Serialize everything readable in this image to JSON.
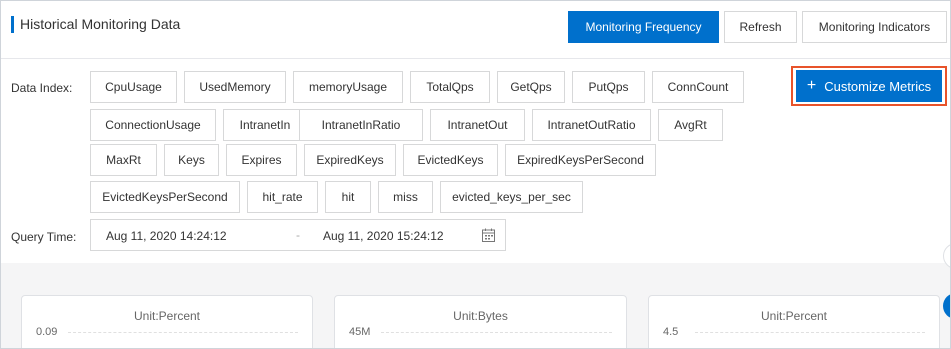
{
  "header": {
    "title": "Historical Monitoring Data",
    "buttons": {
      "monitoring_frequency": "Monitoring Frequency",
      "refresh": "Refresh",
      "monitoring_indicators": "Monitoring Indicators"
    }
  },
  "data_index": {
    "label": "Data Index:",
    "metrics": [
      "CpuUsage",
      "UsedMemory",
      "memoryUsage",
      "TotalQps",
      "GetQps",
      "PutQps",
      "ConnCount",
      "ConnectionUsage",
      "IntranetIn",
      "IntranetInRatio",
      "IntranetOut",
      "IntranetOutRatio",
      "AvgRt",
      "MaxRt",
      "Keys",
      "Expires",
      "ExpiredKeys",
      "EvictedKeys",
      "ExpiredKeysPerSecond",
      "EvictedKeysPerSecond",
      "hit_rate",
      "hit",
      "miss",
      "evicted_keys_per_sec"
    ],
    "customize_label": "Customize Metrics",
    "customize_icon": "plus-icon"
  },
  "query_time": {
    "label": "Query Time:",
    "start": "Aug 11, 2020 14:24:12",
    "separator": "-",
    "end": "Aug 11, 2020 15:24:12",
    "icon": "calendar-icon"
  },
  "charts": [
    {
      "unit": "Unit:Percent",
      "y_top": "0.09"
    },
    {
      "unit": "Unit:Bytes",
      "y_top": "45M"
    },
    {
      "unit": "Unit:Percent",
      "y_top": "4.5"
    }
  ],
  "colors": {
    "primary": "#0070cc",
    "highlight_outline": "#e8532a",
    "border": "#d7d8d9"
  }
}
